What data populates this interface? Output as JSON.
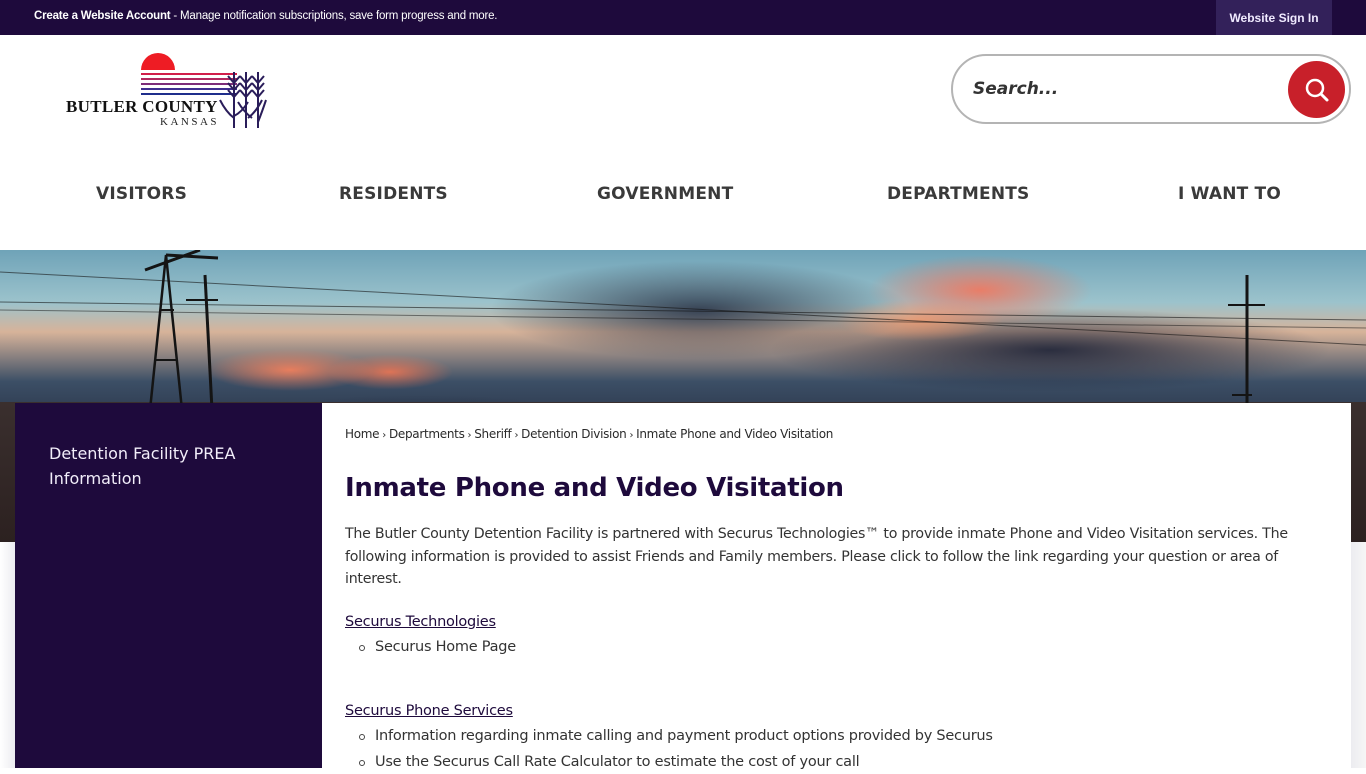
{
  "topbar": {
    "account_bold": "Create a Website Account",
    "account_rest": " - Manage notification subscriptions, save form progress and more.",
    "sign_in": "Website Sign In"
  },
  "logo": {
    "name": "BUTLER COUNTY",
    "state": "KANSAS"
  },
  "search": {
    "placeholder": "Search...",
    "button_icon": "search-icon"
  },
  "nav": {
    "items": [
      {
        "label": "VISITORS"
      },
      {
        "label": "RESIDENTS"
      },
      {
        "label": "GOVERNMENT"
      },
      {
        "label": "DEPARTMENTS"
      },
      {
        "label": "I WANT TO"
      }
    ]
  },
  "sidebar": {
    "items": [
      {
        "label": "Detention Facility PREA Information"
      }
    ]
  },
  "breadcrumb": {
    "items": [
      "Home",
      "Departments",
      "Sheriff",
      "Detention Division"
    ],
    "current": "Inmate Phone and Video Visitation",
    "separator": "›"
  },
  "content": {
    "title": "Inmate Phone and Video Visitation",
    "intro": "The Butler County Detention Facility is partnered with Securus Technologies™ to provide inmate Phone and Video Visitation services. The following information is provided to assist Friends and Family members. Please click to follow the link regarding your question or area of interest.",
    "sections": [
      {
        "link": "Securus Technologies",
        "bullets": [
          "Securus Home Page"
        ]
      },
      {
        "link": "Securus Phone Services",
        "bullets": [
          "Information regarding inmate calling and payment product options provided by Securus",
          "Use the Securus Call Rate Calculator to estimate the cost of your call"
        ]
      }
    ]
  },
  "colors": {
    "brand_purple": "#1e0a3c",
    "signin_bg": "#33215a",
    "search_red": "#c8202a"
  }
}
